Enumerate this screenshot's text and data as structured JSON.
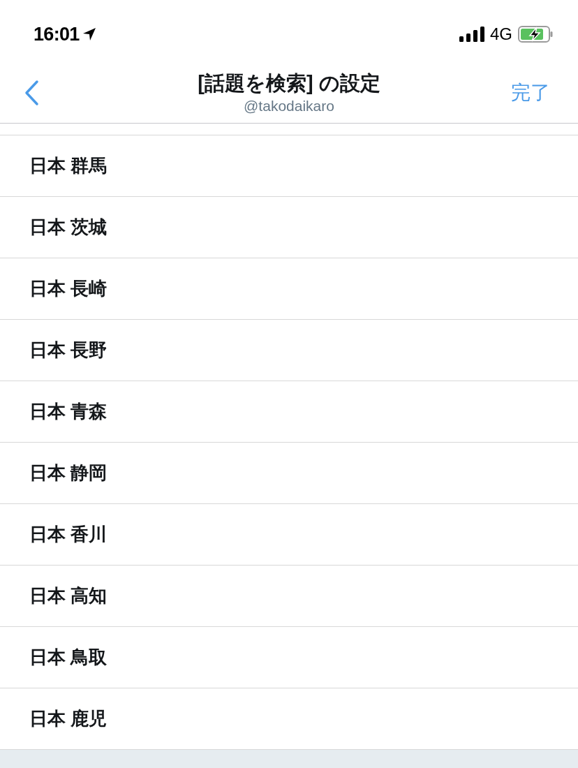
{
  "status_bar": {
    "time": "16:01",
    "network": "4G"
  },
  "header": {
    "title": "[話題を検索] の設定",
    "subtitle": "@takodaikaro",
    "done": "完了"
  },
  "locations": [
    "日本 群馬",
    "日本 茨城",
    "日本 長崎",
    "日本 長野",
    "日本 青森",
    "日本 静岡",
    "日本 香川",
    "日本 高知",
    "日本 鳥取",
    "日本 鹿児"
  ]
}
